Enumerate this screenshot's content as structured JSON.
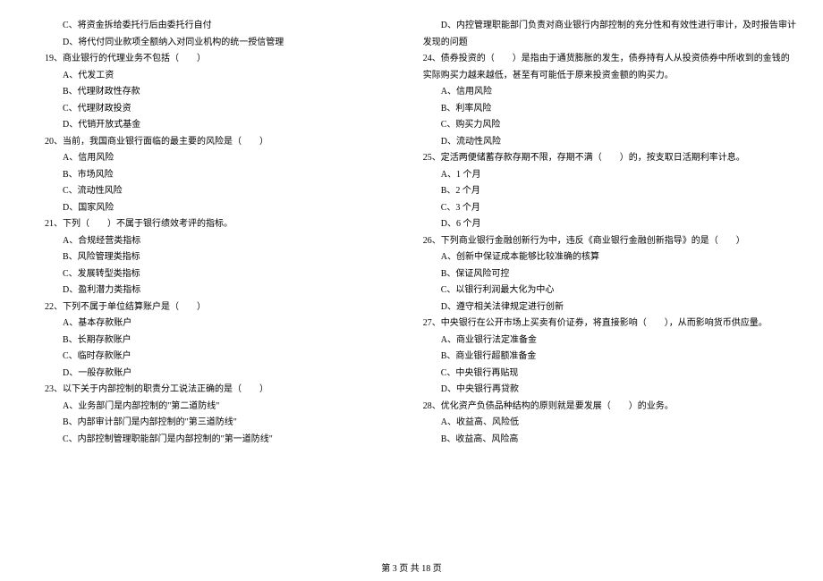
{
  "left": {
    "opt18c": "C、将资金拆给委托行后由委托行自付",
    "opt18d": "D、将代付同业款项全额纳入对同业机构的统一授信管理",
    "q19": "19、商业银行的代理业务不包括（　　）",
    "opt19a": "A、代发工资",
    "opt19b": "B、代理财政性存款",
    "opt19c": "C、代理财政投资",
    "opt19d": "D、代销开放式基金",
    "q20": "20、当前，我国商业银行面临的最主要的风险是（　　）",
    "opt20a": "A、信用风险",
    "opt20b": "B、市场风险",
    "opt20c": "C、流动性风险",
    "opt20d": "D、国家风险",
    "q21": "21、下列（　　）不属于银行绩效考评的指标。",
    "opt21a": "A、合规经营类指标",
    "opt21b": "B、风险管理类指标",
    "opt21c": "C、发展转型类指标",
    "opt21d": "D、盈利潜力类指标",
    "q22": "22、下列不属于单位结算账户是（　　）",
    "opt22a": "A、基本存款账户",
    "opt22b": "B、长期存款账户",
    "opt22c": "C、临时存款账户",
    "opt22d": "D、一般存款账户",
    "q23": "23、以下关于内部控制的职责分工说法正确的是（　　）",
    "opt23a": "A、业务部门是内部控制的\"第二道防线\"",
    "opt23b": "B、内部审计部门是内部控制的\"第三道防线\"",
    "opt23c": "C、内部控制管理职能部门是内部控制的\"第一道防线\""
  },
  "right": {
    "opt23d": "D、内控管理职能部门负责对商业银行内部控制的充分性和有效性进行审计，及时报告审计",
    "opt23d2": "发现的问题",
    "q24": "24、债券投资的（　　）是指由于通货膨胀的发生，债券持有人从投资债券中所收到的金钱的",
    "q24b": "实际购买力越来越低，甚至有可能低于原来投资金额的购买力。",
    "opt24a": "A、信用风险",
    "opt24b": "B、利率风险",
    "opt24c": "C、购买力风险",
    "opt24d": "D、流动性风险",
    "q25": "25、定活两便储蓄存款存期不限，存期不满（　　）的，按支取日活期利率计息。",
    "opt25a": "A、1 个月",
    "opt25b": "B、2 个月",
    "opt25c": "C、3 个月",
    "opt25d": "D、6 个月",
    "q26": "26、下列商业银行金融创新行为中，违反《商业银行金融创新指导》的是（　　）",
    "opt26a": "A、创新中保证成本能够比较准确的核算",
    "opt26b": "B、保证风险可控",
    "opt26c": "C、以银行利润最大化为中心",
    "opt26d": "D、遵守相关法律规定进行创新",
    "q27": "27、中央银行在公开市场上买卖有价证券，将直接影响（　　），从而影响货币供应量。",
    "opt27a": "A、商业银行法定准备金",
    "opt27b": "B、商业银行超额准备金",
    "opt27c": "C、中央银行再贴现",
    "opt27d": "D、中央银行再贷款",
    "q28": "28、优化资产负债品种结构的原则就是要发展（　　）的业务。",
    "opt28a": "A、收益高、风险低",
    "opt28b": "B、收益高、风险高"
  },
  "footer": "第 3 页 共 18 页"
}
